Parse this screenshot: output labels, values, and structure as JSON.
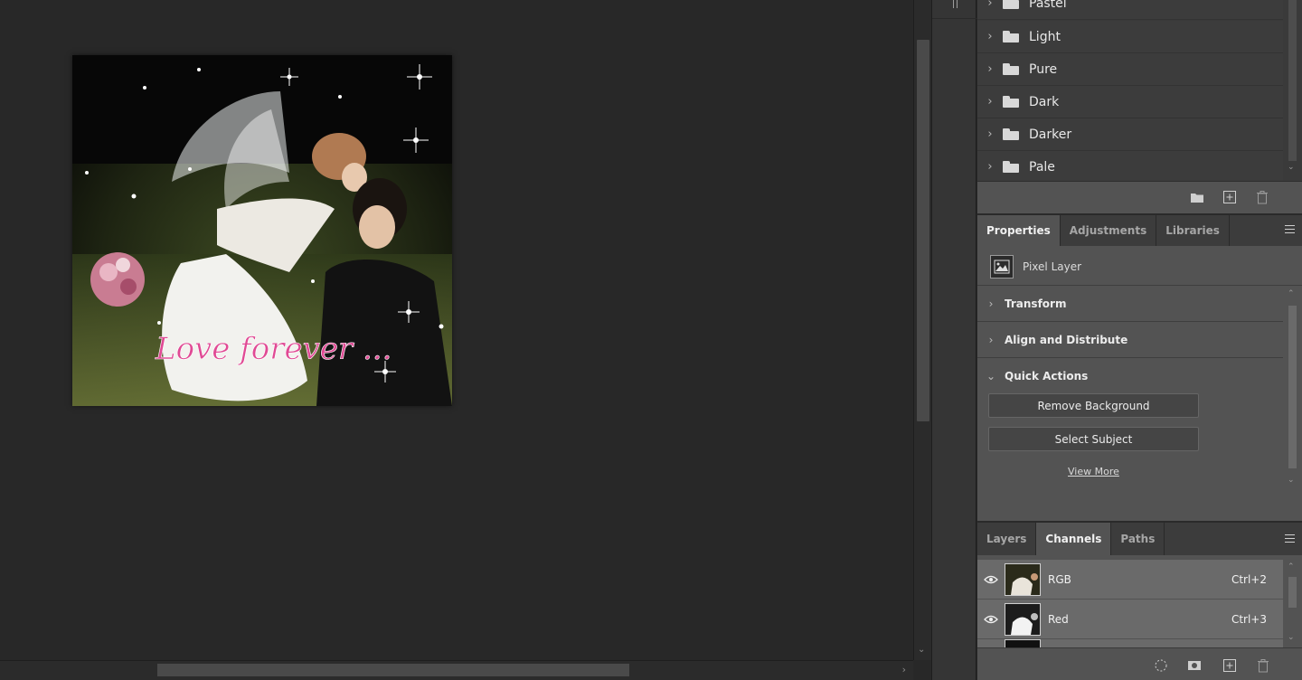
{
  "swatch_groups": [
    {
      "label": "Pastel"
    },
    {
      "label": "Light"
    },
    {
      "label": "Pure"
    },
    {
      "label": "Dark"
    },
    {
      "label": "Darker"
    },
    {
      "label": "Pale"
    }
  ],
  "properties": {
    "tabs": [
      "Properties",
      "Adjustments",
      "Libraries"
    ],
    "active_tab": "Properties",
    "layer_type": "Pixel Layer",
    "sections": {
      "transform": "Transform",
      "align": "Align and Distribute",
      "quick_actions": "Quick Actions"
    },
    "buttons": {
      "remove_bg": "Remove Background",
      "select_subject": "Select Subject",
      "view_more": "View More"
    }
  },
  "channels_panel": {
    "tabs": [
      "Layers",
      "Channels",
      "Paths"
    ],
    "active_tab": "Channels",
    "rows": [
      {
        "name": "RGB",
        "shortcut": "Ctrl+2"
      },
      {
        "name": "Red",
        "shortcut": "Ctrl+3"
      }
    ]
  },
  "document": {
    "overlay_text": "Love forever ..."
  },
  "colors": {
    "workspace": "#282828",
    "panel": "#535353",
    "panel_dark": "#3c3c3c",
    "channel_row": "#6a6a6a"
  }
}
